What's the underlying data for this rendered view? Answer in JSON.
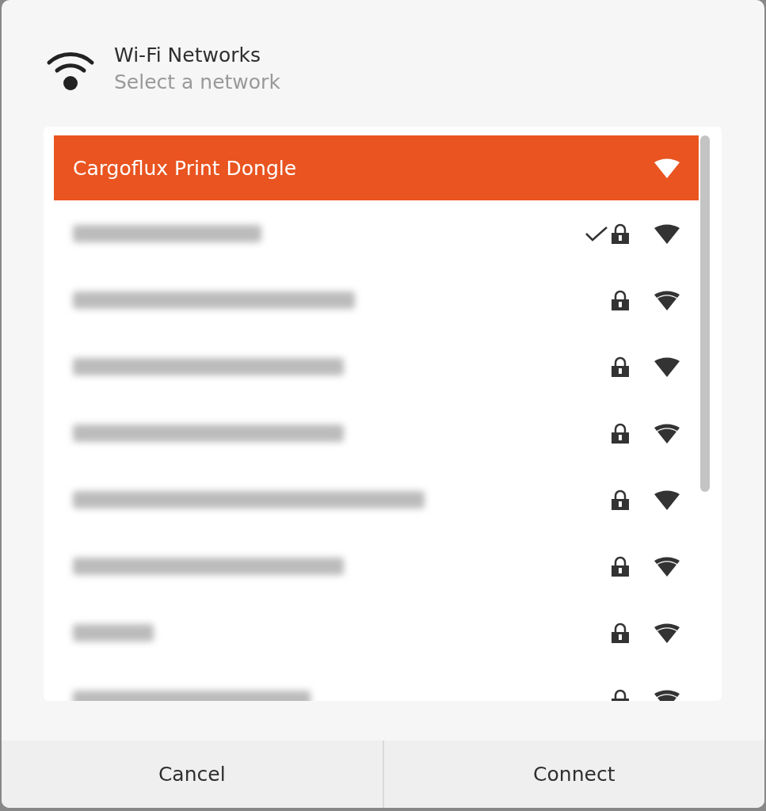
{
  "header": {
    "title": "Wi-Fi Networks",
    "subtitle": "Select a network"
  },
  "networks": [
    {
      "kind": "named",
      "name": "Cargoflux Print Dongle",
      "selected": true,
      "connected": false,
      "secured": false,
      "strong_signal": true
    },
    {
      "kind": "blurred",
      "selected": false,
      "connected": true,
      "secured": true,
      "strong_signal": true
    },
    {
      "kind": "blurred",
      "selected": false,
      "connected": false,
      "secured": true,
      "strong_signal": false
    },
    {
      "kind": "blurred",
      "selected": false,
      "connected": false,
      "secured": true,
      "strong_signal": true
    },
    {
      "kind": "blurred",
      "selected": false,
      "connected": false,
      "secured": true,
      "strong_signal": false
    },
    {
      "kind": "blurred",
      "selected": false,
      "connected": false,
      "secured": true,
      "strong_signal": true
    },
    {
      "kind": "blurred",
      "selected": false,
      "connected": false,
      "secured": true,
      "strong_signal": false
    },
    {
      "kind": "blurred",
      "selected": false,
      "connected": false,
      "secured": true,
      "strong_signal": false
    },
    {
      "kind": "blurred",
      "selected": false,
      "connected": false,
      "secured": true,
      "strong_signal": false
    }
  ],
  "buttons": [
    "Cancel",
    "Connect"
  ]
}
